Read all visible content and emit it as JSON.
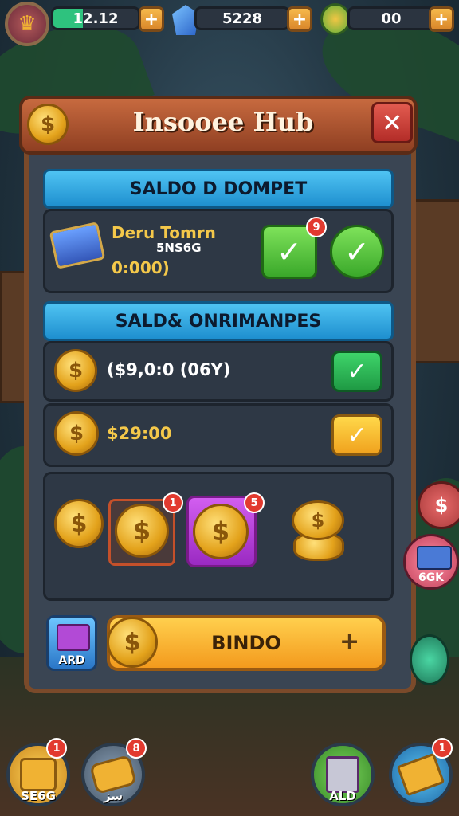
{
  "top_bar": {
    "resources": [
      {
        "value": "12.12",
        "icon": "coin-stack-icon",
        "fill": 0.35
      },
      {
        "value": "5228",
        "icon": "gem-icon"
      },
      {
        "value": "00",
        "icon": "shield-icon"
      }
    ],
    "plus_label": "+"
  },
  "panel": {
    "title": "Insooee Hub",
    "close_label": "✕",
    "coin_symbol": "$",
    "section1": {
      "title": "SALDO D DOMPET",
      "wallet_name": "Deru Tomrn",
      "wallet_amount": "5NS6G",
      "wallet_balance": "0:000)",
      "badge": "9"
    },
    "section2": {
      "title": "SALD& ONRIMANPES",
      "rows": [
        {
          "amount": "($9,0:0 (06Y)"
        },
        {
          "amount": "$29:00"
        }
      ]
    },
    "rewards": {
      "badge1": "1",
      "badge2": "5"
    },
    "bundle_label": "ARD",
    "main_button": "BINDO",
    "main_button_plus": "+",
    "check_mark": "✓"
  },
  "side_buttons": [
    {
      "label": "",
      "icon": "dollar-icon"
    },
    {
      "label": "6GK",
      "icon": "ticket-icon"
    }
  ],
  "bottom_nav": [
    {
      "label": "SE6G",
      "icon": "coin-bucket-icon",
      "badge": "1"
    },
    {
      "label": "سز",
      "icon": "scroll-icon",
      "badge": "8"
    },
    {
      "label": "ALD",
      "icon": "book-icon",
      "badge": ""
    },
    {
      "label": "",
      "icon": "gold-bars-icon",
      "badge": "1"
    }
  ],
  "colors": {
    "accent_green": "#2ec27e",
    "section_blue": "#2ea6e2",
    "panel_brown": "#7a4a2a",
    "gold": "#f0b233"
  }
}
